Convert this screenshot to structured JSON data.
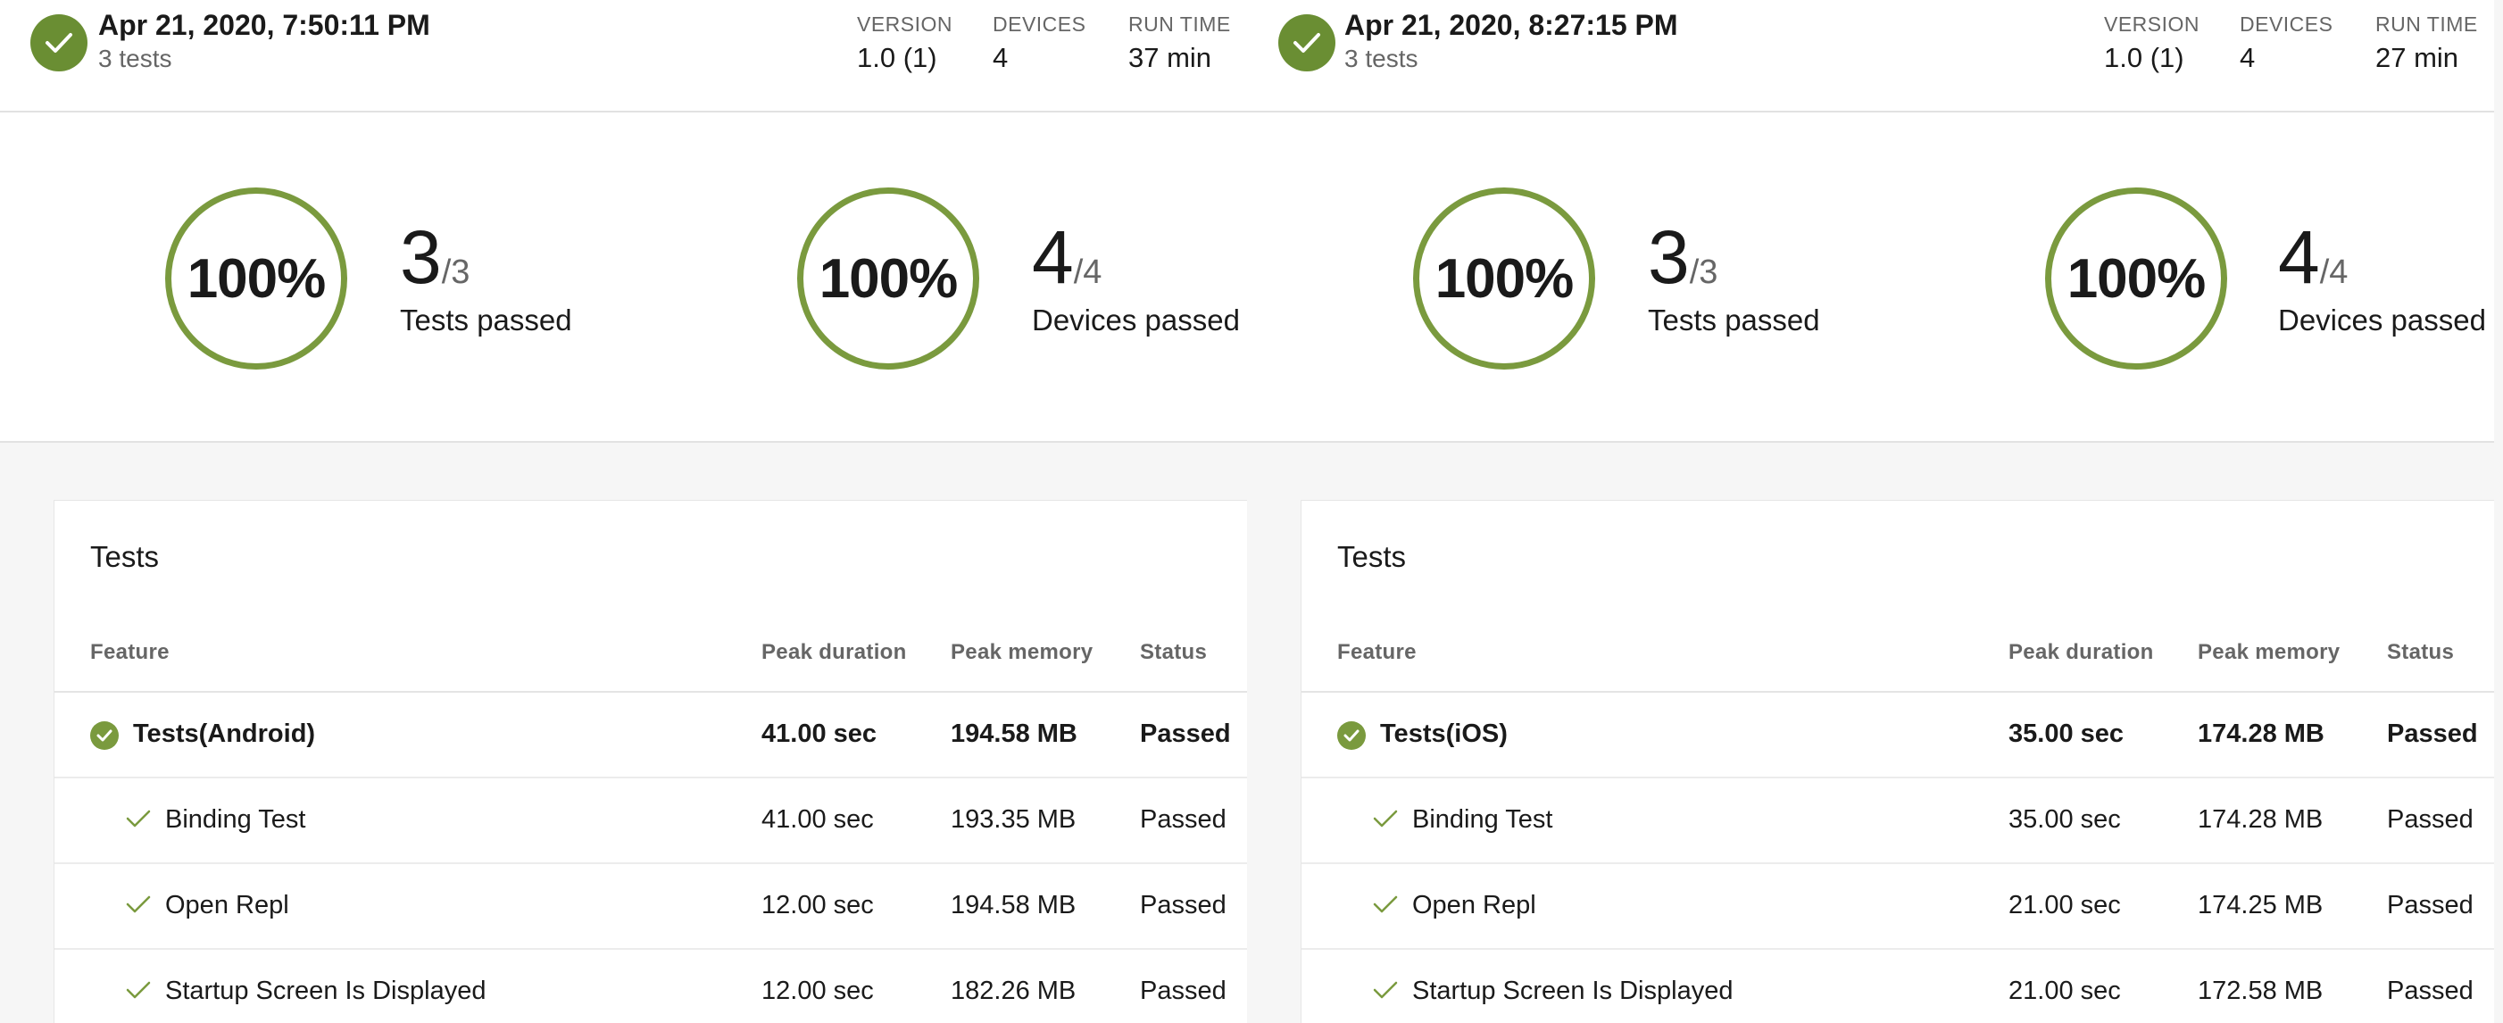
{
  "runs": [
    {
      "date": "Apr 21, 2020, 7:50:11 PM",
      "subtitle": "3 tests",
      "meta": [
        {
          "label": "VERSION",
          "value": "1.0 (1)"
        },
        {
          "label": "DEVICES",
          "value": "4"
        },
        {
          "label": "RUN TIME",
          "value": "37 min"
        }
      ],
      "summary": [
        {
          "percent": "100%",
          "passed": "3",
          "total": "/3",
          "label": "Tests passed"
        },
        {
          "percent": "100%",
          "passed": "4",
          "total": "/4",
          "label": "Devices passed"
        }
      ],
      "tests": {
        "title": "Tests",
        "columns": [
          "Feature",
          "Peak duration",
          "Peak memory",
          "Status"
        ],
        "rows": [
          {
            "feature": "Tests(Android)",
            "duration": "41.00 sec",
            "memory": "194.58 MB",
            "status": "Passed"
          },
          {
            "feature": "Binding Test",
            "duration": "41.00 sec",
            "memory": "193.35 MB",
            "status": "Passed"
          },
          {
            "feature": "Open Repl",
            "duration": "12.00 sec",
            "memory": "194.58 MB",
            "status": "Passed"
          },
          {
            "feature": "Startup Screen Is Displayed",
            "duration": "12.00 sec",
            "memory": "182.26 MB",
            "status": "Passed"
          }
        ]
      }
    },
    {
      "date": "Apr 21, 2020, 8:27:15 PM",
      "subtitle": "3 tests",
      "meta": [
        {
          "label": "VERSION",
          "value": "1.0 (1)"
        },
        {
          "label": "DEVICES",
          "value": "4"
        },
        {
          "label": "RUN TIME",
          "value": "27 min"
        }
      ],
      "summary": [
        {
          "percent": "100%",
          "passed": "3",
          "total": "/3",
          "label": "Tests passed"
        },
        {
          "percent": "100%",
          "passed": "4",
          "total": "/4",
          "label": "Devices passed"
        }
      ],
      "tests": {
        "title": "Tests",
        "columns": [
          "Feature",
          "Peak duration",
          "Peak memory",
          "Status"
        ],
        "rows": [
          {
            "feature": "Tests(iOS)",
            "duration": "35.00 sec",
            "memory": "174.28 MB",
            "status": "Passed"
          },
          {
            "feature": "Binding Test",
            "duration": "35.00 sec",
            "memory": "174.28 MB",
            "status": "Passed"
          },
          {
            "feature": "Open Repl",
            "duration": "21.00 sec",
            "memory": "174.25 MB",
            "status": "Passed"
          },
          {
            "feature": "Startup Screen Is Displayed",
            "duration": "21.00 sec",
            "memory": "172.58 MB",
            "status": "Passed"
          }
        ]
      }
    }
  ],
  "colors": {
    "success": "#6a8e33",
    "ring": "#7a9a3e"
  },
  "icons": {
    "run_status": "check-circle-icon",
    "row_group": "check-circle-icon",
    "row_item": "check-icon"
  }
}
